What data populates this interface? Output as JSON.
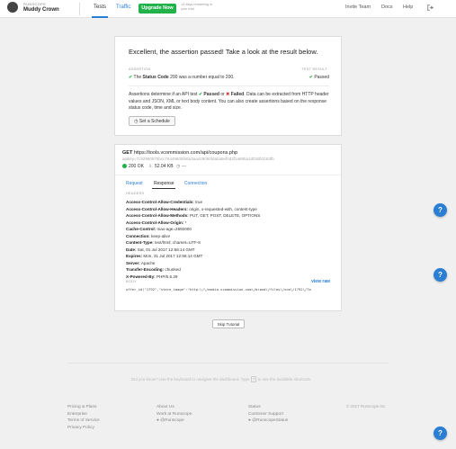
{
  "nav": {
    "org_label": "RUNSCOPE",
    "org_name": "Muddy Crown",
    "tests": "Tests",
    "traffic": "Traffic",
    "upgrade": "Upgrade Now",
    "days_remaining": "14 days remaining in your trial",
    "invite": "Invite Team",
    "docs": "Docs",
    "help": "Help"
  },
  "result_card": {
    "title": "Excellent, the assertion passed! Take a look at the result below.",
    "col_assertion": "ASSERTION",
    "col_result": "TEST RESULT",
    "assertion_prefix": "The",
    "assertion_bold": "Status Code",
    "assertion_suffix": "200 was a number equal to 200.",
    "result_text": "Passed",
    "desc_1": "Assertions determine if an API test",
    "desc_passed": "Passed",
    "desc_or": "or",
    "desc_failed": "Failed",
    "desc_2": ". Data can be extracted from HTTP header values and JSON, XML or text body content. You can also create assertions based on the response status code, time and size.",
    "schedule_button": "Set a Schedule"
  },
  "request_card": {
    "method": "GET",
    "url": "https://tools.vcommission.com/api/coupons.php",
    "apikey": "apikey=7c52960975bcc7644960bfe8a3aa429050fdaba9ef0d3f1a89ba1d03db3183fb",
    "status": "200 OK",
    "size": "52.04 KB",
    "time": "—",
    "tabs": {
      "request": "Request",
      "response": "Response",
      "connection": "Connection"
    },
    "headers_label": "HEADERS",
    "headers": [
      {
        "name": "Access-Control-Allow-Credentials:",
        "value": " true"
      },
      {
        "name": "Access-Control-Allow-Headers:",
        "value": " origin, x-requested-with, content-type"
      },
      {
        "name": "Access-Control-Allow-Methods:",
        "value": " PUT, GET, POST, DELETE, OPTIONS"
      },
      {
        "name": "Access-Control-Allow-Origin:",
        "value": " *"
      },
      {
        "name": "Cache-Control:",
        "value": " max-age=2592000"
      },
      {
        "name": "Connection:",
        "value": " keep-alive"
      },
      {
        "name": "Content-Type:",
        "value": " text/html; charset=UTF-8"
      },
      {
        "name": "Date:",
        "value": " Sat, 01 Jul 2017 12:56:14 GMT"
      },
      {
        "name": "Expires:",
        "value": " Mon, 31 Jul 2017 12:56:14 GMT"
      },
      {
        "name": "Server:",
        "value": " Apache"
      },
      {
        "name": "Transfer-Encoding:",
        "value": " chunked"
      },
      {
        "name": "X-Powered-By:",
        "value": " PHP/5.6.29"
      }
    ],
    "body_label": "BODY",
    "view_raw": "view raw",
    "body": "offer_id❘\"1792\",\"store_image\":\"http:\\/\\/media.vcommission.com\\/brand\\/files\\/vcm\\/1792\\/Ta"
  },
  "skip_tutorial": "Skip Tutorial",
  "footer": {
    "hint_pre": "Did you know? Use the keyboard to navigate the dashboard. Type",
    "hint_key": "?",
    "hint_post": "to see the available shortcuts.",
    "col1": [
      "Pricing & Plans",
      "Enterprise",
      "Terms of Service",
      "Privacy Policy"
    ],
    "col2": [
      "About Us",
      "Work at Runscope",
      "@Runscope"
    ],
    "col3": [
      "Status",
      "Customer Support",
      "@RunscopeStatus"
    ],
    "copyright": "© 2017 Runscope Inc."
  },
  "colors": {
    "accent": "#2a7fd4",
    "success": "#21b24a",
    "failure": "#d63b3b"
  }
}
